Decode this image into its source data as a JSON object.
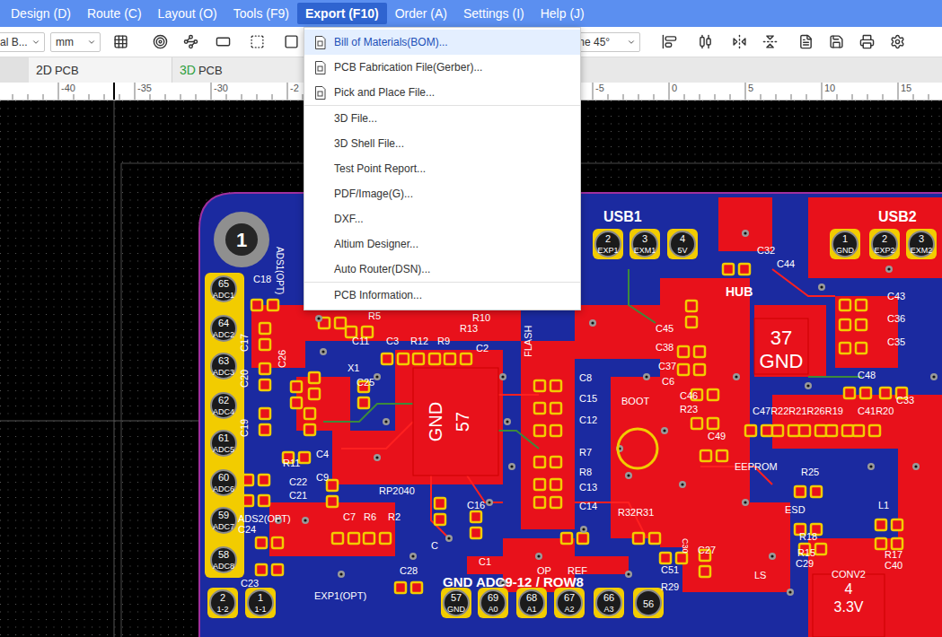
{
  "menu_bar": [
    {
      "label": "Design (D)",
      "selected": false
    },
    {
      "label": "Route (C)",
      "selected": false
    },
    {
      "label": "Layout (O)",
      "selected": false
    },
    {
      "label": "Tools (F9)",
      "selected": false
    },
    {
      "label": "Export (F10)",
      "selected": true
    },
    {
      "label": "Order (A)",
      "selected": false
    },
    {
      "label": "Settings (I)",
      "selected": false
    },
    {
      "label": "Help (J)",
      "selected": false
    }
  ],
  "toolbar": {
    "layer_select": "al B...",
    "unit_select": "mm",
    "route_select": "Line 45°"
  },
  "tabs": [
    {
      "prefix": "2D",
      "label": "PCB",
      "selected": true,
      "color": "#333333"
    },
    {
      "prefix": "3D",
      "label": "PCB",
      "selected": false,
      "color": "#2e9e3c"
    }
  ],
  "ruler": [
    "-40",
    "-35",
    "-30",
    "-2",
    "-5",
    "0",
    "5",
    "10",
    "15"
  ],
  "export_menu": {
    "groups": [
      [
        {
          "label": "Bill of Materials(BOM)...",
          "kind": "icon",
          "highlighted": true
        },
        {
          "label": "PCB Fabrication File(Gerber)...",
          "kind": "icon",
          "highlighted": false
        },
        {
          "label": "Pick and Place File...",
          "kind": "icon",
          "highlighted": false
        }
      ],
      [
        {
          "label": "3D File...",
          "kind": "plain",
          "highlighted": false
        },
        {
          "label": "3D Shell File...",
          "kind": "plain",
          "highlighted": false
        },
        {
          "label": "Test Point Report...",
          "kind": "plain",
          "highlighted": false
        },
        {
          "label": "PDF/Image(G)...",
          "kind": "plain",
          "highlighted": false
        },
        {
          "label": "DXF...",
          "kind": "plain",
          "highlighted": false
        },
        {
          "label": "Altium Designer...",
          "kind": "plain",
          "highlighted": false
        },
        {
          "label": "Auto Router(DSN)...",
          "kind": "plain",
          "highlighted": false
        }
      ],
      [
        {
          "label": "PCB Information...",
          "kind": "plain",
          "highlighted": false
        }
      ]
    ]
  },
  "pcb": {
    "mounting_hole": "1",
    "left_header": [
      {
        "number": "65",
        "name": "ADC1"
      },
      {
        "number": "64",
        "name": "ADC2"
      },
      {
        "number": "63",
        "name": "ADC3"
      },
      {
        "number": "62",
        "name": "ADC4"
      },
      {
        "number": "61",
        "name": "ADC5"
      },
      {
        "number": "60",
        "name": "ADC6"
      },
      {
        "number": "59",
        "name": "ADC7"
      },
      {
        "number": "58",
        "name": "ADC8"
      }
    ],
    "usb1_pins": [
      {
        "number": "2",
        "name": "EXP1"
      },
      {
        "number": "3",
        "name": "EXM1"
      },
      {
        "number": "4",
        "name": "5V"
      }
    ],
    "usb2_pins": [
      {
        "number": "1",
        "name": "GND"
      },
      {
        "number": "2",
        "name": "EXP2"
      },
      {
        "number": "3",
        "name": "EXM2"
      }
    ],
    "bottom_pins": [
      {
        "number": "57",
        "name": "GND"
      },
      {
        "number": "69",
        "name": "A0"
      },
      {
        "number": "68",
        "name": "A1"
      },
      {
        "number": "67",
        "name": "A2"
      },
      {
        "number": "66",
        "name": "A3"
      },
      {
        "number": "56",
        "name": ""
      }
    ],
    "corner_pins": [
      {
        "number": "2",
        "name": "1-2"
      },
      {
        "number": "1",
        "name": "1-1"
      }
    ],
    "thermal_pads": [
      {
        "number": "57",
        "name": "GND"
      },
      {
        "number": "37",
        "name": "GND"
      },
      {
        "number": "4",
        "name": "3.3V"
      }
    ],
    "labels": [
      "USB1",
      "USB2",
      "HUB",
      "ADS1(OPT)",
      "C18",
      "C17",
      "C26",
      "C20",
      "C19",
      "R5",
      "C11",
      "C3",
      "R12",
      "R9",
      "R13",
      "R10",
      "C2",
      "FLASH",
      "X1",
      "C25",
      "R11",
      "C22",
      "C21",
      "C9",
      "C4",
      "RP2040",
      "ADS2(OPT)",
      "C24",
      "C7",
      "R6",
      "R2",
      "C23",
      "C28",
      "EXP1(OPT)",
      "C16",
      "C8",
      "C15",
      "C12",
      "R7",
      "R8",
      "C13",
      "C14",
      "BOOT",
      "C45",
      "C38",
      "C37",
      "C6",
      "C46",
      "R23",
      "C32",
      "C44",
      "C43",
      "C36",
      "C35",
      "C48",
      "C33",
      "C47R22R21R26R19",
      "C41R20",
      "C49",
      "EEPROM",
      "R25",
      "ESD",
      "R18",
      "R15",
      "C29",
      "CONV2",
      "L1",
      "R17",
      "C40",
      "C27",
      "C51",
      "R29",
      "LS",
      "R32R31",
      "OP",
      "REF",
      "GND ADC9-12 / ROW8",
      "C",
      "C1",
      "C30"
    ]
  }
}
